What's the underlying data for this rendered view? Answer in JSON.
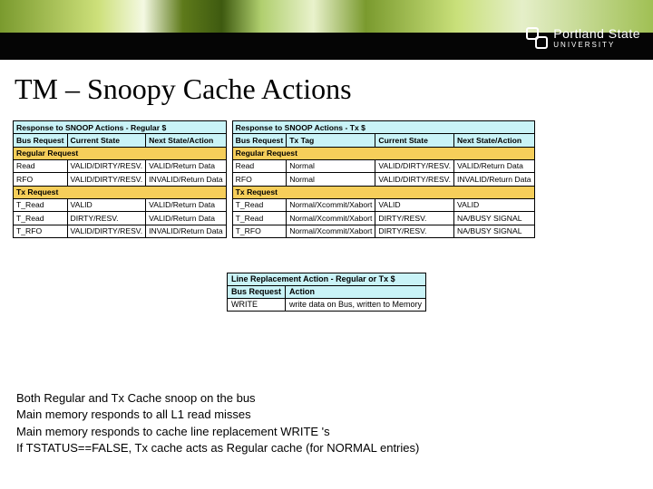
{
  "brand": {
    "name": "Portland State",
    "subtitle": "UNIVERSITY"
  },
  "title": "TM – Snoopy Cache Actions",
  "tableLeft": {
    "caption": "Response to SNOOP Actions - Regular $",
    "headers": [
      "Bus Request",
      "Current State",
      "Next State/Action"
    ],
    "sections": [
      {
        "label": "Regular Request",
        "rows": [
          [
            "Read",
            "VALID/DIRTY/RESV.",
            "VALID/Return Data"
          ],
          [
            "RFO",
            "VALID/DIRTY/RESV.",
            "INVALID/Return Data"
          ]
        ]
      },
      {
        "label": "Tx Request",
        "rows": [
          [
            "T_Read",
            "VALID",
            "VALID/Return Data"
          ],
          [
            "T_Read",
            "DIRTY/RESV.",
            "VALID/Return Data"
          ],
          [
            "T_RFO",
            "VALID/DIRTY/RESV.",
            "INVALID/Return Data"
          ]
        ]
      }
    ]
  },
  "tableRight": {
    "caption": "Response to SNOOP Actions - Tx $",
    "headers": [
      "Bus Request",
      "Tx Tag",
      "Current State",
      "Next State/Action"
    ],
    "sections": [
      {
        "label": "Regular Request",
        "rows": [
          [
            "Read",
            "Normal",
            "VALID/DIRTY/RESV.",
            "VALID/Return Data"
          ],
          [
            "RFO",
            "Normal",
            "VALID/DIRTY/RESV.",
            "INVALID/Return Data"
          ]
        ]
      },
      {
        "label": "Tx Request",
        "rows": [
          [
            "T_Read",
            "Normal/Xcommit/Xabort",
            "VALID",
            "VALID"
          ],
          [
            "T_Read",
            "Normal/Xcommit/Xabort",
            "DIRTY/RESV.",
            "NA/BUSY SIGNAL"
          ],
          [
            "T_RFO",
            "Normal/Xcommit/Xabort",
            "DIRTY/RESV.",
            "NA/BUSY SIGNAL"
          ]
        ]
      }
    ]
  },
  "tableCenter": {
    "caption": "Line Replacement Action - Regular or Tx $",
    "headers": [
      "Bus Request",
      "Action"
    ],
    "rows": [
      [
        "WRITE",
        "write data on Bus, written to Memory"
      ]
    ]
  },
  "notes": [
    "Both Regular and Tx Cache snoop on the bus",
    "Main memory responds to all L1 read misses",
    "Main memory responds to cache line replacement  WRITE 's",
    "If TSTATUS==FALSE, Tx cache acts as Regular cache (for NORMAL entries)"
  ]
}
